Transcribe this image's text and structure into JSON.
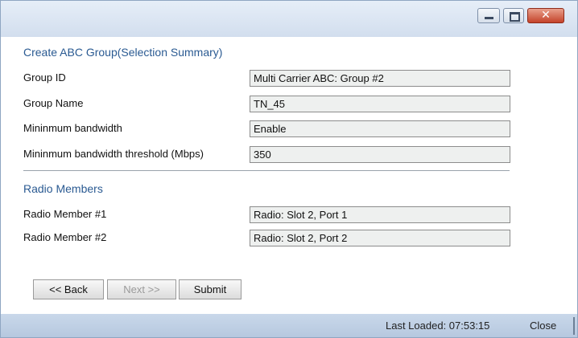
{
  "window": {
    "controls": {
      "minimize_icon": "minimize-icon",
      "maximize_icon": "maximize-icon",
      "close_glyph": "✕"
    }
  },
  "summary": {
    "title": "Create ABC Group(Selection Summary)",
    "rows": [
      {
        "label": "Group ID",
        "value": "Multi Carrier ABC: Group #2"
      },
      {
        "label": "Group Name",
        "value": "TN_45"
      },
      {
        "label": "Mininmum bandwidth",
        "value": "Enable"
      },
      {
        "label": "Mininmum bandwidth threshold (Mbps)",
        "value": "350"
      }
    ]
  },
  "radio_members": {
    "title": "Radio Members",
    "rows": [
      {
        "label": "Radio Member #1",
        "value": "Radio: Slot 2, Port 1"
      },
      {
        "label": "Radio Member #2",
        "value": "Radio: Slot 2, Port 2"
      }
    ]
  },
  "buttons": {
    "back": "<< Back",
    "next": "Next >>",
    "submit": "Submit"
  },
  "status": {
    "last_loaded": "Last Loaded: 07:53:15",
    "close": "Close"
  }
}
